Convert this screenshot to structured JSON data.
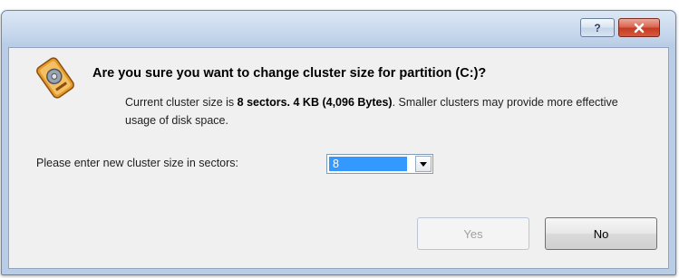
{
  "titlebar": {
    "help_glyph": "?",
    "close_glyph": "×"
  },
  "dialog": {
    "question": "Are you sure you want to change cluster size for partition (C:)?",
    "desc_prefix": "Current cluster size is ",
    "desc_current": "8 sectors. 4 KB (4,096 Bytes)",
    "desc_suffix": ". Smaller clusters may provide more effective usage of disk space.",
    "size_label": "Please enter new cluster size in sectors:",
    "size_value": "8"
  },
  "buttons": {
    "yes": "Yes",
    "no": "No"
  },
  "colors": {
    "selection": "#3399ff",
    "close_button": "#c43a22",
    "disabled_text": "#a0a0a0"
  }
}
